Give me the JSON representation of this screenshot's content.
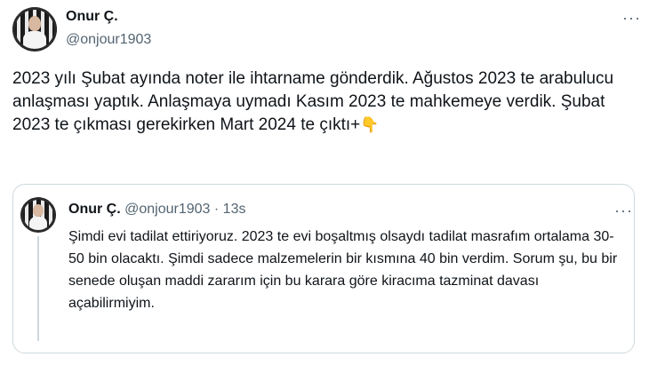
{
  "tweet": {
    "author_name": "Onur Ç.",
    "author_handle": "@onjour1903",
    "text": "2023 yılı Şubat ayında noter ile ihtarname gönderdik. Ağustos 2023 te arabulucu anlaşması yaptık. Anlaşmaya uymadı Kasım 2023 te mahkemeye verdik. Şubat 2023 te çıkması gerekirken Mart 2024 te çıktı+",
    "emoji": "👇",
    "more_label": "···"
  },
  "quoted": {
    "author_name": "Onur Ç.",
    "author_handle": "@onjour1903",
    "separator": "·",
    "time": "13s",
    "text": "Şimdi evi tadilat ettiriyoruz. 2023 te evi boşaltmış olsaydı tadilat masrafım ortalama 30-50 bin olacaktı. Şimdi sadece malzemelerin bir kısmına 40 bin verdim. Sorum şu, bu bir senede oluşan maddi zararım için bu karara göre kiracıma tazminat davası açabilirmiyim.",
    "more_label": "···"
  },
  "icons": {
    "avatar": "avatar-photo-icon",
    "more": "more-options-icon",
    "emoji": "backhand-index-pointing-down-icon"
  },
  "colors": {
    "text": "#0f1419",
    "secondary": "#536471",
    "border": "#cfd9de"
  }
}
